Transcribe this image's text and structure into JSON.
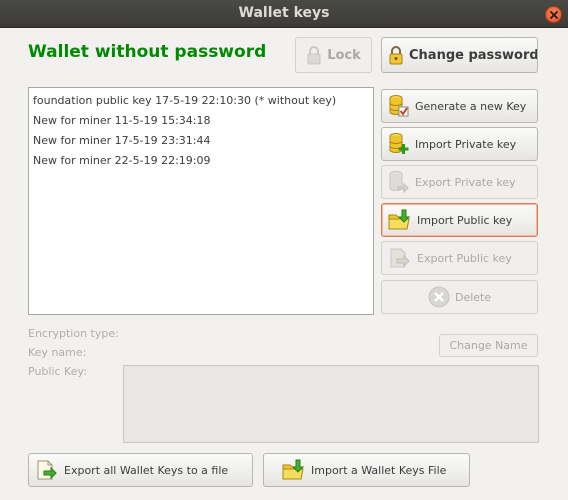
{
  "window": {
    "title": "Wallet keys"
  },
  "status_heading": "Wallet without password",
  "buttons": {
    "lock": "Lock",
    "change_password": "Change password",
    "generate_key": "Generate a new Key",
    "import_private": "Import Private key",
    "export_private": "Export Private key",
    "import_public": "Import Public key",
    "export_public": "Export Public key",
    "delete": "Delete",
    "change_name": "Change Name",
    "export_all": "Export all Wallet Keys to a file",
    "import_file": "Import a Wallet Keys File"
  },
  "keys": [
    "foundation public key 17-5-19 22:10:30 (* without key)",
    "New for miner 11-5-19 15:34:18",
    "New for miner 17-5-19 23:31:44",
    "New for miner 22-5-19 22:19:09"
  ],
  "details": {
    "encryption_label": "Encryption type:",
    "key_name_label": "Key name:",
    "public_key_label": "Public Key:"
  },
  "colors": {
    "heading": "#008a00",
    "titlebar": "#3c3b37",
    "close": "#e2502a",
    "focus": "#e07a54"
  }
}
